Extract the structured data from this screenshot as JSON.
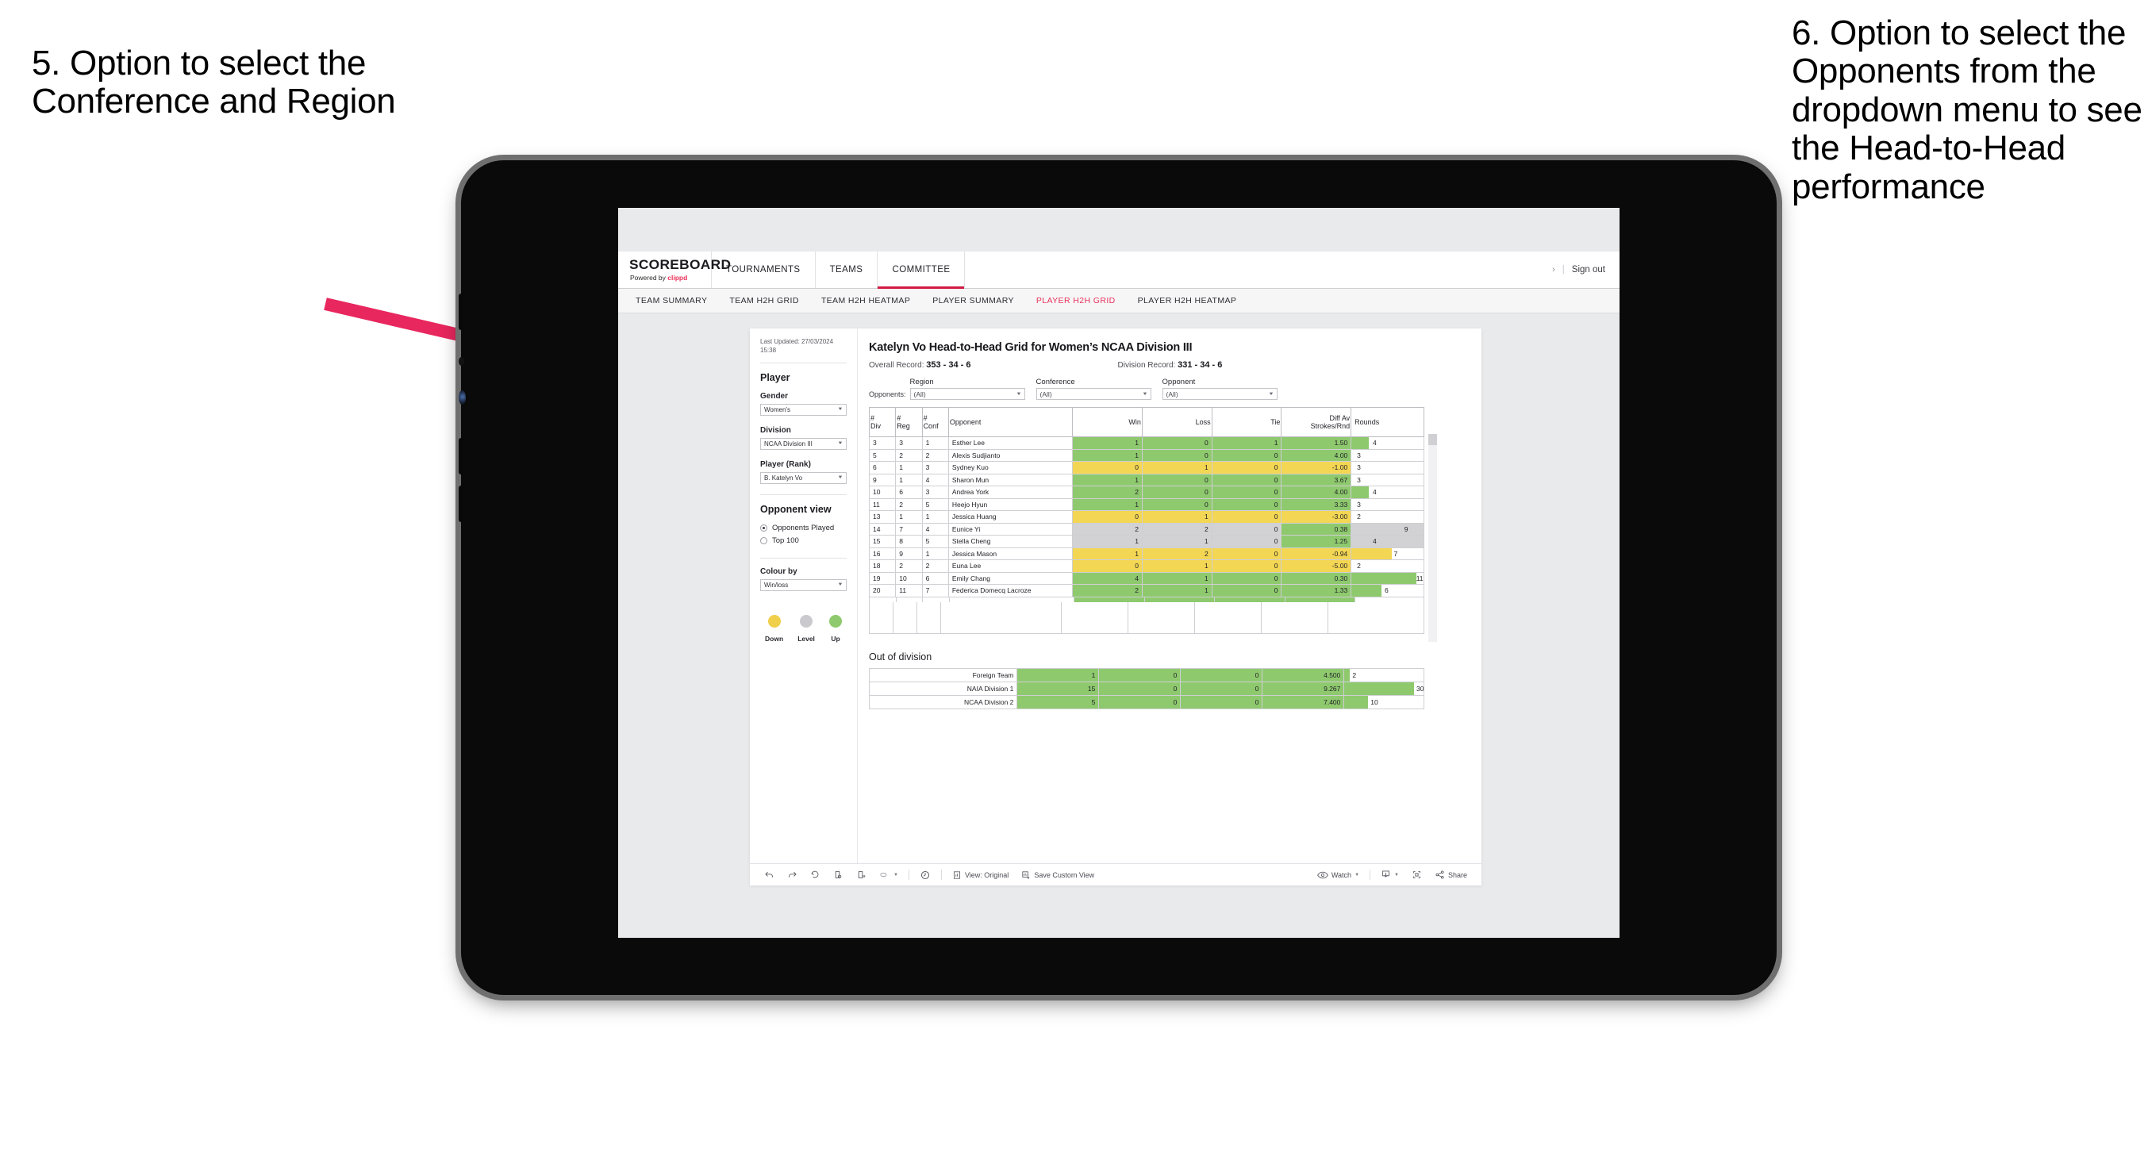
{
  "annotations": {
    "left": "5. Option to select the Conference and Region",
    "right": "6. Option to select the Opponents from the dropdown menu to see the Head-to-Head performance"
  },
  "app": {
    "brand": {
      "title": "SCOREBOARD",
      "powered_prefix": "Powered by ",
      "powered_brand": "clippd"
    },
    "top_nav": [
      {
        "label": "TOURNAMENTS",
        "active": false
      },
      {
        "label": "TEAMS",
        "active": false
      },
      {
        "label": "COMMITTEE",
        "active": true
      }
    ],
    "sign_out": "Sign out",
    "chevron": "›",
    "divider": "|",
    "sub_nav": [
      {
        "label": "TEAM SUMMARY",
        "active": false
      },
      {
        "label": "TEAM H2H GRID",
        "active": false
      },
      {
        "label": "TEAM H2H HEATMAP",
        "active": false
      },
      {
        "label": "PLAYER SUMMARY",
        "active": false
      },
      {
        "label": "PLAYER H2H GRID",
        "active": true
      },
      {
        "label": "PLAYER H2H HEATMAP",
        "active": false
      }
    ],
    "accent_color": "#e8335a"
  },
  "sidebar": {
    "last_updated": "Last Updated: 27/03/2024 15:38",
    "player_heading": "Player",
    "gender": {
      "label": "Gender",
      "value": "Women’s"
    },
    "division": {
      "label": "Division",
      "value": "NCAA Division III"
    },
    "player_rank": {
      "label": "Player (Rank)",
      "value": "B. Katelyn Vo"
    },
    "opponent_view": {
      "heading": "Opponent view",
      "options": [
        {
          "label": "Opponents Played",
          "selected": true
        },
        {
          "label": "Top 100",
          "selected": false
        }
      ]
    },
    "colour_by": {
      "label": "Colour by",
      "value": "Win/loss"
    },
    "legend": [
      {
        "label": "Down",
        "color": "#f0cf4a"
      },
      {
        "label": "Level",
        "color": "#c9c9ce"
      },
      {
        "label": "Up",
        "color": "#8ec96e"
      }
    ]
  },
  "main": {
    "title": "Katelyn Vo Head-to-Head Grid for Women’s NCAA Division III",
    "overall_record": {
      "label": "Overall Record: ",
      "value": "353 -  34 - 6"
    },
    "division_record": {
      "label": "Division Record: ",
      "value": "331 -  34 - 6"
    },
    "opponents_label": "Opponents:",
    "filters": [
      {
        "label": "Region",
        "value": "(All)"
      },
      {
        "label": "Conference",
        "value": "(All)"
      },
      {
        "label": "Opponent",
        "value": "(All)"
      }
    ],
    "out_of_division_heading": "Out of division"
  },
  "chart_data": {
    "type": "table",
    "title": "Katelyn Vo Head-to-Head Grid for Women’s NCAA Division III",
    "columns": [
      "# Div",
      "# Reg",
      "# Conf",
      "Opponent",
      "Win",
      "Loss",
      "Tie",
      "Diff Av Strokes/Rnd",
      "Rounds"
    ],
    "header_lines": [
      [
        "#",
        "Div"
      ],
      [
        "#",
        "Reg"
      ],
      [
        "#",
        "Conf"
      ],
      [
        "Opponent"
      ],
      [
        "Win"
      ],
      [
        "Loss"
      ],
      [
        "Tie"
      ],
      [
        "Diff Av",
        "Strokes/Rnd"
      ],
      [
        "Rounds"
      ]
    ],
    "rows": [
      {
        "div": "3",
        "reg": "3",
        "conf": "1",
        "opponent": "Esther Lee",
        "win": "1",
        "loss": "0",
        "tie": "1",
        "diff": "1.50",
        "rounds": "4",
        "state": "up",
        "bar_pct": 24
      },
      {
        "div": "5",
        "reg": "2",
        "conf": "2",
        "opponent": "Alexis Sudjianto",
        "win": "1",
        "loss": "0",
        "tie": "0",
        "diff": "4.00",
        "rounds": "3",
        "state": "up",
        "bar_pct": 0
      },
      {
        "div": "6",
        "reg": "1",
        "conf": "3",
        "opponent": "Sydney Kuo",
        "win": "0",
        "loss": "1",
        "tie": "0",
        "diff": "-1.00",
        "rounds": "3",
        "state": "down",
        "bar_pct": 0
      },
      {
        "div": "9",
        "reg": "1",
        "conf": "4",
        "opponent": "Sharon Mun",
        "win": "1",
        "loss": "0",
        "tie": "0",
        "diff": "3.67",
        "rounds": "3",
        "state": "up",
        "bar_pct": 0
      },
      {
        "div": "10",
        "reg": "6",
        "conf": "3",
        "opponent": "Andrea York",
        "win": "2",
        "loss": "0",
        "tie": "0",
        "diff": "4.00",
        "rounds": "4",
        "state": "up",
        "bar_pct": 24
      },
      {
        "div": "11",
        "reg": "2",
        "conf": "5",
        "opponent": "Heejo Hyun",
        "win": "1",
        "loss": "0",
        "tie": "0",
        "diff": "3.33",
        "rounds": "3",
        "state": "up",
        "bar_pct": 0
      },
      {
        "div": "13",
        "reg": "1",
        "conf": "1",
        "opponent": "Jessica Huang",
        "win": "0",
        "loss": "1",
        "tie": "0",
        "diff": "-3.00",
        "rounds": "2",
        "state": "down",
        "bar_pct": 0
      },
      {
        "div": "14",
        "reg": "7",
        "conf": "4",
        "opponent": "Eunice Yi",
        "win": "2",
        "loss": "2",
        "tie": "0",
        "diff": "0.38",
        "rounds": "9",
        "state": "level",
        "bar_pct": 72
      },
      {
        "div": "15",
        "reg": "8",
        "conf": "5",
        "opponent": "Stella Cheng",
        "win": "1",
        "loss": "1",
        "tie": "0",
        "diff": "1.25",
        "rounds": "4",
        "state": "level",
        "bar_pct": 24
      },
      {
        "div": "16",
        "reg": "9",
        "conf": "1",
        "opponent": "Jessica Mason",
        "win": "1",
        "loss": "2",
        "tie": "0",
        "diff": "-0.94",
        "rounds": "7",
        "state": "down",
        "bar_pct": 56
      },
      {
        "div": "18",
        "reg": "2",
        "conf": "2",
        "opponent": "Euna Lee",
        "win": "0",
        "loss": "1",
        "tie": "0",
        "diff": "-5.00",
        "rounds": "2",
        "state": "down",
        "bar_pct": 0
      },
      {
        "div": "19",
        "reg": "10",
        "conf": "6",
        "opponent": "Emily Chang",
        "win": "4",
        "loss": "1",
        "tie": "0",
        "diff": "0.30",
        "rounds": "11",
        "state": "up",
        "bar_pct": 90
      },
      {
        "div": "20",
        "reg": "11",
        "conf": "7",
        "opponent": "Federica Domecq Lacroze",
        "win": "2",
        "loss": "1",
        "tie": "0",
        "diff": "1.33",
        "rounds": "6",
        "state": "up",
        "bar_pct": 42
      }
    ],
    "diff_column_colors": {
      "up": "#8ec96e",
      "down": "#f3d653",
      "level": "#d2d2d5"
    },
    "out_of_division": {
      "heading": "Out of division",
      "rows": [
        {
          "name": "Foreign Team",
          "win": "1",
          "loss": "0",
          "tie": "0",
          "diff": "4.500",
          "rounds": "2",
          "bar_pct": 7
        },
        {
          "name": "NAIA Division 1",
          "win": "15",
          "loss": "0",
          "tie": "0",
          "diff": "9.267",
          "rounds": "30",
          "bar_pct": 88
        },
        {
          "name": "NCAA Division 2",
          "win": "5",
          "loss": "0",
          "tie": "0",
          "diff": "7.400",
          "rounds": "10",
          "bar_pct": 30
        }
      ]
    }
  },
  "toolbar": {
    "undo": "undo-icon",
    "redo": "redo-icon",
    "revert": "revert-icon",
    "refresh": "refresh-data-icon",
    "pause": "pause-auto-update-icon",
    "highlight": "highlight-icon",
    "alerts": "alerts-icon",
    "view_label": "View: Original",
    "save_view_label": "Save Custom View",
    "watch_label": "Watch",
    "download": "download-icon",
    "fullscreen": "fullscreen-icon",
    "share_label": "Share"
  }
}
